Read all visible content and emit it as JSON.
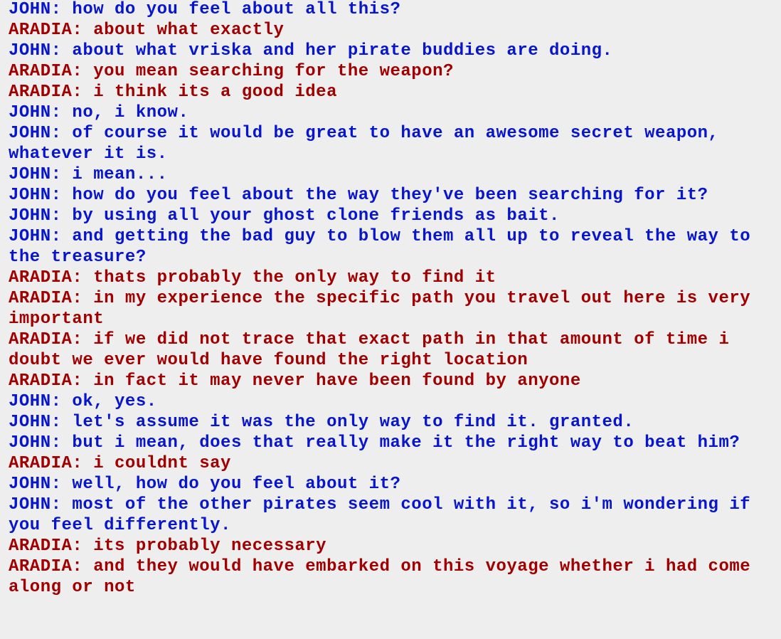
{
  "colors": {
    "john": "#0715cd",
    "aradia": "#a10000",
    "background": "#eeeeee"
  },
  "lines": [
    {
      "speaker": "john",
      "text": "JOHN: how do you feel about all this?"
    },
    {
      "speaker": "aradia",
      "text": "ARADIA: about what exactly"
    },
    {
      "speaker": "john",
      "text": "JOHN: about what vriska and her pirate buddies are doing."
    },
    {
      "speaker": "aradia",
      "text": "ARADIA: you mean searching for the weapon?"
    },
    {
      "speaker": "aradia",
      "text": "ARADIA: i think its a good idea"
    },
    {
      "speaker": "john",
      "text": "JOHN: no, i know."
    },
    {
      "speaker": "john",
      "text": "JOHN: of course it would be great to have an awesome secret weapon, whatever it is."
    },
    {
      "speaker": "john",
      "text": "JOHN: i mean..."
    },
    {
      "speaker": "john",
      "text": "JOHN: how do you feel about the way they've been searching for it?"
    },
    {
      "speaker": "john",
      "text": "JOHN: by using all your ghost clone friends as bait."
    },
    {
      "speaker": "john",
      "text": "JOHN: and getting the bad guy to blow them all up to reveal the way to the treasure?"
    },
    {
      "speaker": "aradia",
      "text": "ARADIA: thats probably the only way to find it"
    },
    {
      "speaker": "aradia",
      "text": "ARADIA: in my experience the specific path you travel out here is very important"
    },
    {
      "speaker": "aradia",
      "text": "ARADIA: if we did not trace that exact path in that amount of time i doubt we ever would have found the right location"
    },
    {
      "speaker": "aradia",
      "text": "ARADIA: in fact it may never have been found by anyone"
    },
    {
      "speaker": "john",
      "text": "JOHN: ok, yes."
    },
    {
      "speaker": "john",
      "text": "JOHN: let's assume it was the only way to find it. granted."
    },
    {
      "speaker": "john",
      "text": "JOHN: but i mean, does that really make it the right way to beat him?"
    },
    {
      "speaker": "aradia",
      "text": "ARADIA: i couldnt say"
    },
    {
      "speaker": "john",
      "text": "JOHN: well, how do you feel about it?"
    },
    {
      "speaker": "john",
      "text": "JOHN: most of the other pirates seem cool with it, so i'm wondering if you feel differently."
    },
    {
      "speaker": "aradia",
      "text": "ARADIA: its probably necessary"
    },
    {
      "speaker": "aradia",
      "text": "ARADIA: and they would have embarked on this voyage whether i had come along or not"
    }
  ]
}
